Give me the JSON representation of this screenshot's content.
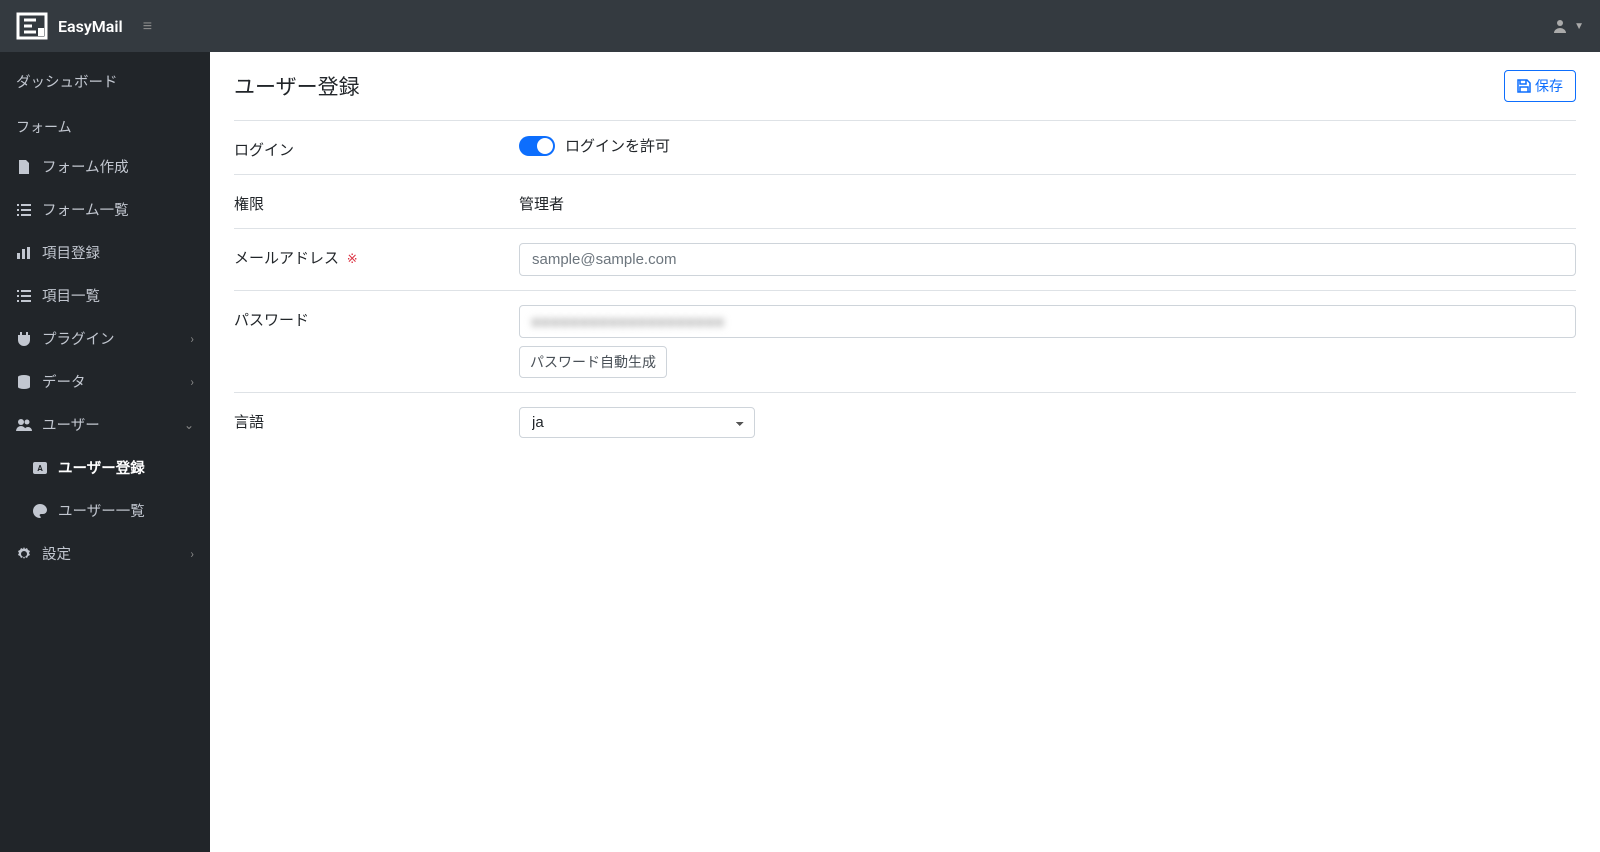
{
  "navbar": {
    "brand": "EasyMail"
  },
  "sidebar": {
    "dashboard": "ダッシュボード",
    "forms_heading": "フォーム",
    "form_create": "フォーム作成",
    "form_list": "フォーム一覧",
    "item_register": "項目登録",
    "item_list": "項目一覧",
    "plugin": "プラグイン",
    "data": "データ",
    "user": "ユーザー",
    "user_register": "ユーザー登録",
    "user_list": "ユーザー一覧",
    "settings": "設定"
  },
  "page": {
    "title": "ユーザー登録",
    "save_button": "保存"
  },
  "form": {
    "login_label": "ログイン",
    "login_toggle_label": "ログインを許可",
    "role_label": "権限",
    "role_value": "管理者",
    "email_label": "メールアドレス",
    "email_required_mark": "※",
    "email_placeholder": "sample@sample.com",
    "password_label": "パスワード",
    "password_generate": "パスワード自動生成",
    "language_label": "言語",
    "language_value": "ja"
  }
}
